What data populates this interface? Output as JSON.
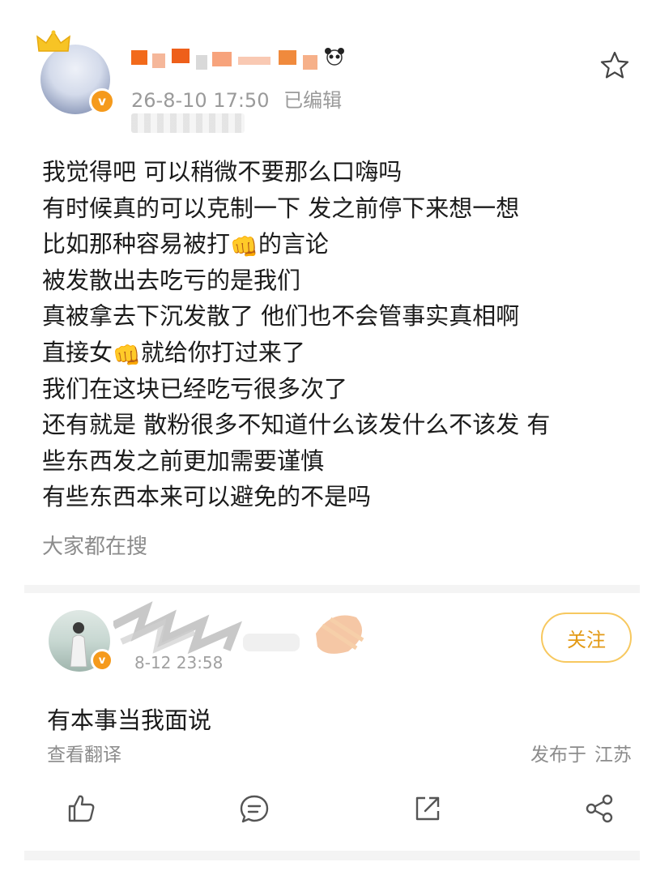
{
  "post": {
    "timestamp": "26-8-10 17:50",
    "edited_label": "已编辑",
    "lines": [
      {
        "parts": [
          {
            "t": "我觉得吧 可以稍微不要那么口嗨吗"
          }
        ]
      },
      {
        "parts": [
          {
            "t": "有时候真的可以克制一下 发之前停下来想一想"
          }
        ]
      },
      {
        "parts": [
          {
            "t": "比如那种容易被打"
          },
          {
            "emoji": "👊"
          },
          {
            "t": "的言论"
          }
        ]
      },
      {
        "parts": [
          {
            "t": "被发散出去吃亏的是我们"
          }
        ]
      },
      {
        "parts": [
          {
            "t": "真被拿去下沉发散了 他们也不会管事实真相啊"
          }
        ]
      },
      {
        "parts": [
          {
            "t": "直接女"
          },
          {
            "emoji": "👊"
          },
          {
            "t": "就给你打过来了"
          }
        ]
      },
      {
        "parts": [
          {
            "t": "我们在这块已经吃亏很多次了"
          }
        ]
      },
      {
        "parts": [
          {
            "t": "还有就是 散粉很多不知道什么该发什么不该发 有"
          }
        ]
      },
      {
        "parts": [
          {
            "t": "些东西发之前更加需要谨慎"
          }
        ]
      },
      {
        "parts": [
          {
            "t": "有些东西本来可以避免的不是吗"
          }
        ]
      }
    ],
    "search_label": "大家都在搜"
  },
  "comment": {
    "timestamp": "8-12 23:58",
    "follow_label": "关注",
    "text": "有本事当我面说",
    "translate_label": "查看翻译",
    "location_prefix": "发布于",
    "location": "江苏"
  },
  "icons": {
    "star": "star-outline-icon",
    "like": "thumbs-up-icon",
    "comment": "comment-bubble-icon",
    "repost": "repost-icon",
    "share": "share-icon"
  },
  "colors": {
    "accent_orange": "#f59a1c",
    "follow_border": "#f7c85f",
    "follow_text": "#e39a16",
    "muted_text": "#8c8c8c"
  }
}
